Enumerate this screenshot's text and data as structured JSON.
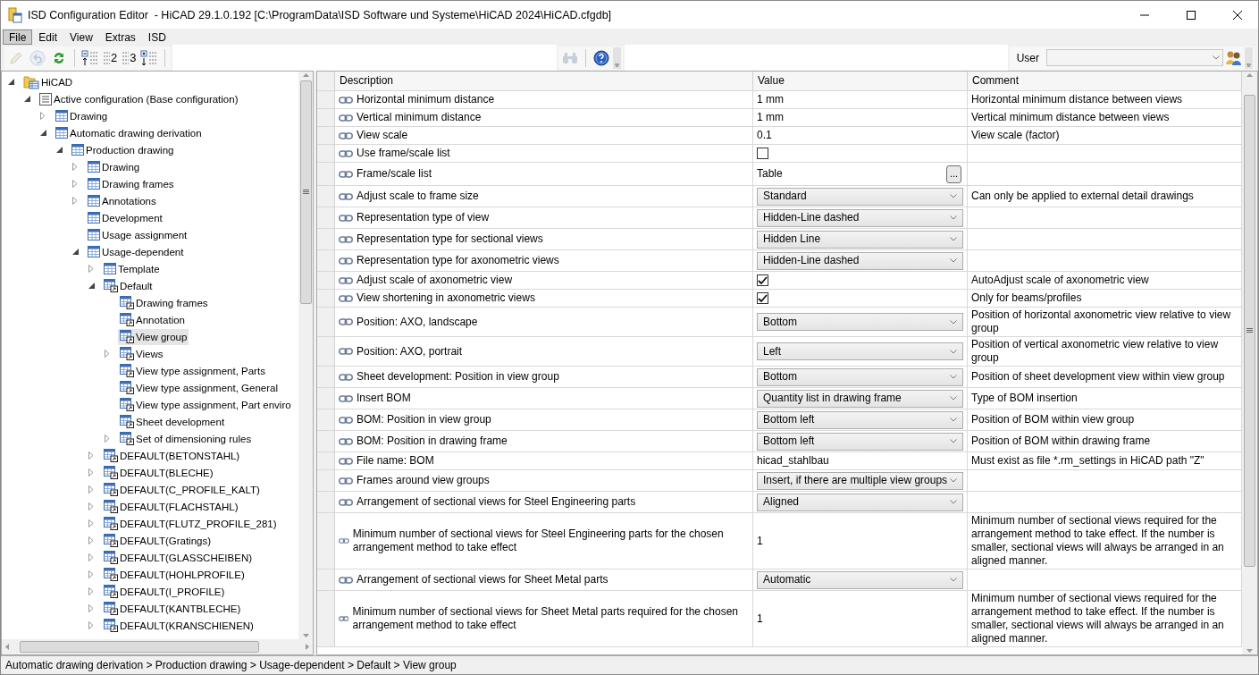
{
  "window": {
    "title": "ISD Configuration Editor  - HiCAD 29.1.0.192 [C:\\ProgramData\\ISD Software und Systeme\\HiCAD 2024\\HiCAD.cfgdb]"
  },
  "menu": [
    {
      "label": "File",
      "selected": true
    },
    {
      "label": "Edit",
      "selected": false
    },
    {
      "label": "View",
      "selected": false
    },
    {
      "label": "Extras",
      "selected": false
    },
    {
      "label": "ISD",
      "selected": false
    }
  ],
  "toolbar": {
    "tools": [
      {
        "kind": "pencil",
        "disabled": true
      },
      {
        "kind": "undo",
        "disabled": true
      },
      {
        "kind": "refresh",
        "disabled": false
      },
      {
        "kind": "separator"
      },
      {
        "kind": "collapse",
        "disabled": false
      },
      {
        "kind": "level",
        "label": "2",
        "disabled": false
      },
      {
        "kind": "level",
        "label": "3",
        "disabled": false
      },
      {
        "kind": "expand",
        "disabled": false
      },
      {
        "kind": "separator"
      }
    ],
    "right_tools": [
      {
        "kind": "binoculars",
        "disabled": true
      },
      {
        "kind": "separator"
      },
      {
        "kind": "help",
        "disabled": false
      }
    ],
    "user": {
      "label": "User"
    }
  },
  "tree": [
    {
      "label": "HiCAD",
      "kind": "branch",
      "expanded": true,
      "linked": false,
      "selected": false,
      "children": [
        {
          "label": "Active configuration (Base configuration)",
          "kind": "branch",
          "expanded": true,
          "linked": false,
          "selected": false,
          "children": [
            {
              "label": "Drawing",
              "kind": "branch",
              "expanded": false,
              "linked": false,
              "selected": false
            },
            {
              "label": "Automatic drawing derivation",
              "kind": "branch",
              "expanded": true,
              "linked": false,
              "selected": false,
              "children": [
                {
                  "label": "Production drawing",
                  "kind": "branch",
                  "expanded": true,
                  "linked": false,
                  "selected": false,
                  "children": [
                    {
                      "label": "Drawing",
                      "kind": "branch",
                      "expanded": false,
                      "linked": false,
                      "selected": false
                    },
                    {
                      "label": "Drawing frames",
                      "kind": "branch",
                      "expanded": false,
                      "linked": false,
                      "selected": false
                    },
                    {
                      "label": "Annotations",
                      "kind": "branch",
                      "expanded": false,
                      "linked": false,
                      "selected": false
                    },
                    {
                      "label": "Development",
                      "kind": "leaf",
                      "linked": false,
                      "selected": false
                    },
                    {
                      "label": "Usage assignment",
                      "kind": "leaf",
                      "linked": false,
                      "selected": false
                    },
                    {
                      "label": "Usage-dependent",
                      "kind": "branch",
                      "expanded": true,
                      "linked": false,
                      "selected": false,
                      "children": [
                        {
                          "label": "Template",
                          "kind": "branch",
                          "expanded": false,
                          "linked": false,
                          "selected": false
                        },
                        {
                          "label": "Default",
                          "kind": "branch",
                          "expanded": true,
                          "linked": true,
                          "selected": false,
                          "children": [
                            {
                              "label": "Drawing frames",
                              "kind": "leaf",
                              "linked": true,
                              "selected": false
                            },
                            {
                              "label": "Annotation",
                              "kind": "leaf",
                              "linked": true,
                              "selected": false
                            },
                            {
                              "label": "View group",
                              "kind": "leaf",
                              "linked": true,
                              "selected": true
                            },
                            {
                              "label": "Views",
                              "kind": "branch",
                              "expanded": false,
                              "linked": true,
                              "selected": false
                            },
                            {
                              "label": "View type assignment, Parts",
                              "kind": "leaf",
                              "linked": true,
                              "selected": false
                            },
                            {
                              "label": "View type assignment, General",
                              "kind": "leaf",
                              "linked": true,
                              "selected": false
                            },
                            {
                              "label": "View type assignment, Part enviro",
                              "kind": "leaf",
                              "linked": true,
                              "selected": false
                            },
                            {
                              "label": "Sheet development",
                              "kind": "leaf",
                              "linked": true,
                              "selected": false
                            },
                            {
                              "label": "Set of dimensioning rules",
                              "kind": "branch",
                              "expanded": false,
                              "linked": true,
                              "selected": false
                            }
                          ]
                        },
                        {
                          "label": "DEFAULT(BETONSTAHL)",
                          "kind": "branch",
                          "expanded": false,
                          "linked": true,
                          "selected": false
                        },
                        {
                          "label": "DEFAULT(BLECHE)",
                          "kind": "branch",
                          "expanded": false,
                          "linked": true,
                          "selected": false
                        },
                        {
                          "label": "DEFAULT(C_PROFILE_KALT)",
                          "kind": "branch",
                          "expanded": false,
                          "linked": true,
                          "selected": false
                        },
                        {
                          "label": "DEFAULT(FLACHSTAHL)",
                          "kind": "branch",
                          "expanded": false,
                          "linked": true,
                          "selected": false
                        },
                        {
                          "label": "DEFAULT(FLUTZ_PROFILE_281)",
                          "kind": "branch",
                          "expanded": false,
                          "linked": true,
                          "selected": false
                        },
                        {
                          "label": "DEFAULT(Gratings)",
                          "kind": "branch",
                          "expanded": false,
                          "linked": true,
                          "selected": false
                        },
                        {
                          "label": "DEFAULT(GLASSCHEIBEN)",
                          "kind": "branch",
                          "expanded": false,
                          "linked": true,
                          "selected": false
                        },
                        {
                          "label": "DEFAULT(HOHLPROFILE)",
                          "kind": "branch",
                          "expanded": false,
                          "linked": true,
                          "selected": false
                        },
                        {
                          "label": "DEFAULT(I_PROFILE)",
                          "kind": "branch",
                          "expanded": false,
                          "linked": true,
                          "selected": false
                        },
                        {
                          "label": "DEFAULT(KANTBLECHE)",
                          "kind": "branch",
                          "expanded": false,
                          "linked": true,
                          "selected": false
                        },
                        {
                          "label": "DEFAULT(KRANSCHIENEN)",
                          "kind": "branch",
                          "expanded": false,
                          "linked": true,
                          "selected": false
                        }
                      ]
                    }
                  ]
                }
              ]
            }
          ]
        }
      ]
    }
  ],
  "table": {
    "columns": [
      "Description",
      "Value",
      "Comment"
    ],
    "rows": [
      {
        "description": "Horizontal minimum distance",
        "kind": "text",
        "value": "1 mm",
        "comment": "Horizontal minimum distance between views"
      },
      {
        "description": "Vertical minimum distance",
        "kind": "text",
        "value": "1 mm",
        "comment": "Vertical minimum distance between views"
      },
      {
        "description": "View scale",
        "kind": "text",
        "value": "0.1",
        "comment": "View scale (factor)"
      },
      {
        "description": "Use frame/scale list",
        "kind": "checkbox",
        "checked": false
      },
      {
        "description": "Frame/scale list",
        "kind": "button",
        "value": "Table",
        "button_label": "..."
      },
      {
        "description": "Adjust scale to frame size",
        "kind": "dropdown",
        "value": "Standard",
        "comment": "Can only be applied to external detail drawings"
      },
      {
        "description": "Representation type of view",
        "kind": "dropdown",
        "value": "Hidden-Line dashed"
      },
      {
        "description": "Representation type for sectional views",
        "kind": "dropdown",
        "value": "Hidden Line"
      },
      {
        "description": "Representation type for axonometric views",
        "kind": "dropdown",
        "value": "Hidden-Line dashed"
      },
      {
        "description": "Adjust scale of axonometric view",
        "kind": "checkbox",
        "checked": true,
        "comment": "AutoAdjust scale of axonometric view"
      },
      {
        "description": "View shortening in axonometric views",
        "kind": "checkbox",
        "checked": true,
        "comment": "Only for beams/profiles"
      },
      {
        "description": "Position: AXO, landscape",
        "kind": "dropdown",
        "value": "Bottom",
        "comment": "Position of horizontal axonometric view relative to view group"
      },
      {
        "description": "Position: AXO, portrait",
        "kind": "dropdown",
        "value": "Left",
        "comment": "Position of vertical axonometric view relative to view group"
      },
      {
        "description": "Sheet development: Position in view group",
        "kind": "dropdown",
        "value": "Bottom",
        "comment": "Position of sheet development view within view group"
      },
      {
        "description": "Insert BOM",
        "kind": "dropdown",
        "value": "Quantity list in drawing frame",
        "comment": "Type of BOM insertion"
      },
      {
        "description": "BOM: Position in view group",
        "kind": "dropdown",
        "value": "Bottom left",
        "comment": "Position of BOM within view group"
      },
      {
        "description": "BOM: Position in drawing frame",
        "kind": "dropdown",
        "value": "Bottom left",
        "comment": "Position of BOM within drawing frame"
      },
      {
        "description": "File name: BOM",
        "kind": "text",
        "value": "hicad_stahlbau",
        "comment": "Must exist as file *.rm_settings in HiCAD path \"Z\""
      },
      {
        "description": "Frames around view groups",
        "kind": "dropdown",
        "value": "Insert, if there are multiple view groups"
      },
      {
        "description": "Arrangement of sectional views for Steel Engineering parts",
        "kind": "dropdown",
        "value": "Aligned"
      },
      {
        "description": "Minimum number of sectional views for Steel Engineering parts for the chosen arrangement method to take effect",
        "kind": "text",
        "value": "1",
        "comment": "Minimum number of sectional views required for the arrangement method to take effect. If the number is smaller, sectional views will always be arranged in an aligned manner."
      },
      {
        "description": "Arrangement of sectional views for Sheet Metal parts",
        "kind": "dropdown",
        "value": "Automatic"
      },
      {
        "description": "Minimum number of sectional views for Sheet Metal parts required for the chosen arrangement method to take effect",
        "kind": "text",
        "value": "1",
        "comment": "Minimum number of sectional views required for the arrangement method to take effect. If the number is smaller, sectional views will always be arranged in an aligned manner."
      }
    ]
  },
  "status_bar": "Automatic drawing derivation > Production drawing > Usage-dependent > Default > View group"
}
